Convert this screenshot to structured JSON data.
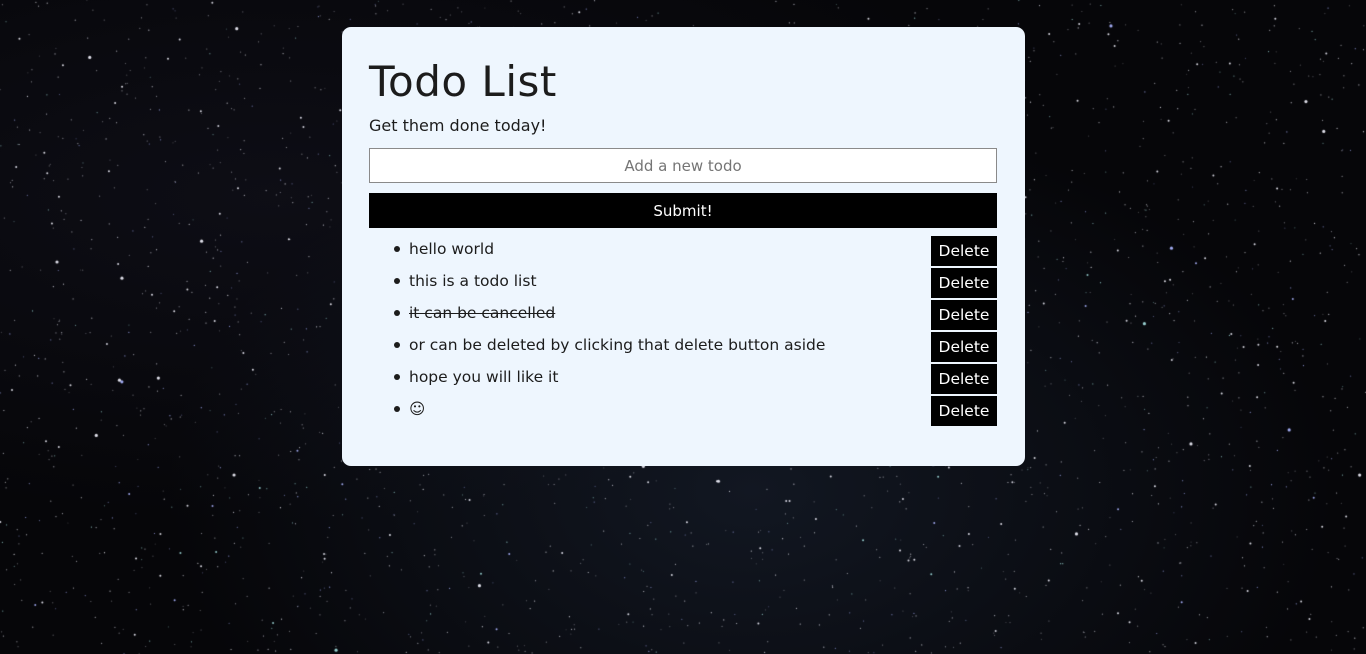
{
  "page": {
    "background": "starry-night-sky",
    "card_color": "#eef6fe"
  },
  "header": {
    "title": "Todo List",
    "subtitle": "Get them done today!"
  },
  "form": {
    "input_value": "",
    "input_placeholder": "Add a new todo",
    "submit_label": "Submit!"
  },
  "todos": [
    {
      "text": "hello world",
      "done": false,
      "delete_label": "Delete"
    },
    {
      "text": "this is a todo list",
      "done": false,
      "delete_label": "Delete"
    },
    {
      "text": "it can be cancelled",
      "done": true,
      "delete_label": "Delete"
    },
    {
      "text": "or can be deleted by clicking that delete button aside",
      "done": false,
      "delete_label": "Delete"
    },
    {
      "text": "hope you will like it",
      "done": false,
      "delete_label": "Delete"
    },
    {
      "text": "☺",
      "done": false,
      "delete_label": "Delete"
    }
  ]
}
